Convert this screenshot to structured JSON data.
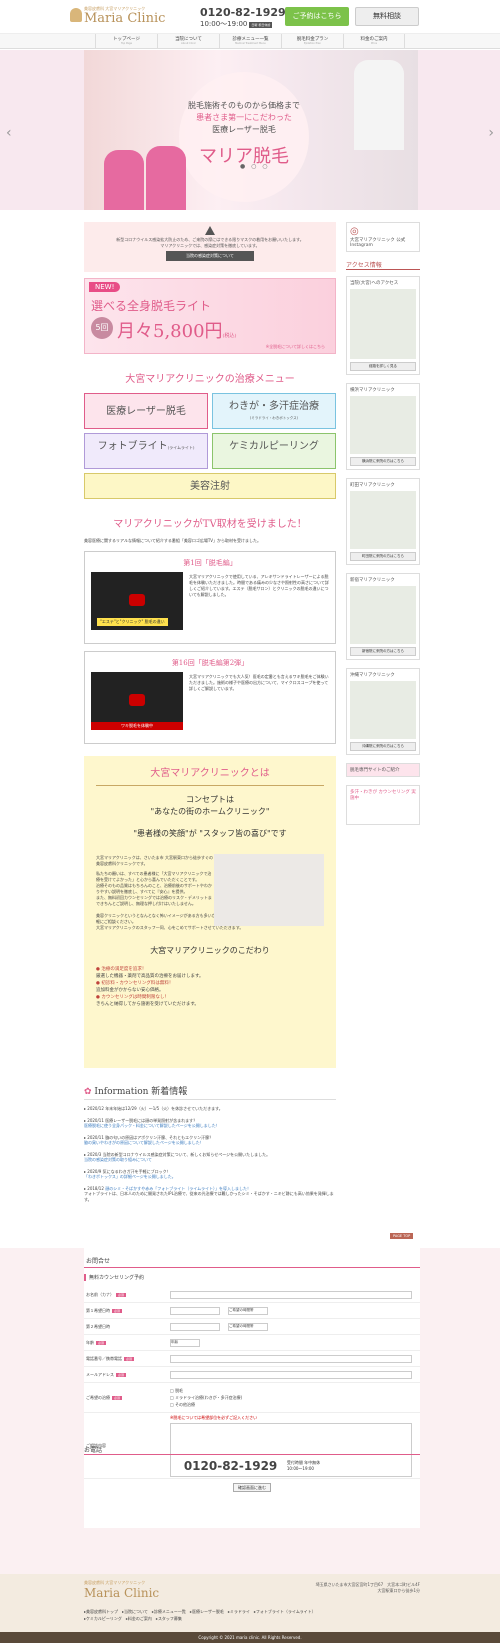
{
  "header": {
    "subtitle": "美容皮膚科 大宮マリアクリニック",
    "clinic_name": "Maria Clinic",
    "tel": "0120-82-1929",
    "hours": "10:00〜19:00",
    "hours_badge": "日曜\n祝日休診",
    "reserve_btn": "ご予約はこちら",
    "consult_btn": "無料相談"
  },
  "nav": [
    {
      "label": "トップページ",
      "sub": "Top Page"
    },
    {
      "label": "当院について",
      "sub": "About Clinic"
    },
    {
      "label": "診療メニュー一覧",
      "sub": "Medical Treatment Menu"
    },
    {
      "label": "脱毛料金プラン",
      "sub": "Epilation Plan"
    },
    {
      "label": "料金のご案内",
      "sub": "Price"
    }
  ],
  "hero": {
    "line1": "脱毛施術そのものから価格まで",
    "line2": "患者さま第一にこだわった",
    "line3": "医療レーザー脱毛",
    "title": "マリア脱毛"
  },
  "notice": {
    "text1": "新型コロナウイルス感染拡大防止のため、ご来院の際にはできる限りマスクの着用をお願いいたします。",
    "text2": "マリアクリニックでは、感染症対策を徹底しています。",
    "button": "当院の感染症対策について"
  },
  "promo": {
    "new": "NEW!",
    "title": "選べる全身脱毛ライト",
    "count": "5回",
    "price": "月々5,800円",
    "tax": "(税込)",
    "link": "※全脱毛について詳しくはこちら"
  },
  "menu": {
    "title": "大宮マリアクリニックの治療メニュー",
    "items": [
      {
        "label": "医療レーザー脱毛",
        "sub": ""
      },
      {
        "label": "わきが・多汗症治療",
        "sub": "(ミラドライ・わきボトックス)"
      },
      {
        "label": "フォトブライト",
        "sub": "(ライムライト)"
      },
      {
        "label": "ケミカルピーリング",
        "sub": ""
      },
      {
        "label": "美容注射",
        "sub": ""
      }
    ]
  },
  "tv": {
    "title": "マリアクリニックがTV取材を受けました！",
    "desc": "美容医療に関するリアルな情報について紹介する番組「美容ロゴ広場TV」から取材を受けました。",
    "items": [
      {
        "heading": "第1回「脱毛編」",
        "text": "大宮マリアクリニックで使用している、アレキサンドライトレーザーによる脱毛を体験いただきました。時間である痛みの少なさや照射性の高さについて詳しくご紹介しています。エステ（脱毛サロン）とクリニックの脱毛の違いについても解説しました。",
        "caption": "\"エステ\"と\"クリニック\" 脱毛の違い"
      },
      {
        "heading": "第16回「脱毛編第2弾」",
        "text": "大宮マリアクリニックでも大人気！医毛の定番とも言えるワキ脱毛をご体験いただきました。施術の様子や医療の出方について、マイクロスコープを使って詳しくご解説しています。",
        "caption": "ワキ脱毛を体験中"
      }
    ]
  },
  "about": {
    "title": "大宮マリアクリニックとは",
    "concept_label": "コンセプトは",
    "concept": "\"あなたの街のホームクリニック\"",
    "quote": "\"患者様の笑顔\"が \"スタッフ皆の喜び\"です",
    "p1": "大宮マリアクリニックは、さいたま市 大宮駅東口から徒歩すぐの美容皮膚科クリニックです。",
    "p2": "私たちの願いは、すべての患者様に「大宮マリアクリニックで治療を受けてよかった」と心から喜んでいただくことです。",
    "p3": "治療そのもの品質はもちろんのこと、治療前後のサポートやわかりやすい説明を徹底し、すべてに『安心』を提供。",
    "p4": "また、無料初回カウンセリングでは治療のリスク・デメリットまできちんとご説明し、無理な押し付けはいたしません。",
    "p5": "美容クリニックというとなんとなく怖いイメージがある方も多いかもしれませんが、まずはぜひ『町のお医者さん』感覚でお気軽にご相談ください。",
    "p6": "大宮マリアクリニックのスタッフ一同、心をこめてサポートさせていただきます。",
    "commit_title": "大宮マリアクリニックのこだわり",
    "commits": [
      "治療の満足度を追求！",
      "厳選した機器・薬剤で高品質の治療をお届けします。",
      "初診料・カウンセリング料は無料！",
      "追加料金がかからない安心価格。",
      "カウンセリングは時間制限なし！",
      "きちんと納得してから施術を受けていただけます。"
    ]
  },
  "info": {
    "title": "Information 新着情報",
    "items": [
      {
        "date": "2020/12",
        "text": "年末年始は12/29（火）〜1/5（火）を休診させていただきます。",
        "link": ""
      },
      {
        "date": "2020/11",
        "text": "医療レーザー脱毛には顔の単発照射が含まれます？",
        "link": "医療脱毛に使う全身パック・料金について解説したページを公開しました！"
      },
      {
        "date": "2020/11",
        "text": "脇の匂いの原因はアポクリン汗腺、それともエクリン汗腺？",
        "link": "脇の臭いやわきがの原因について解説したページを公開しました！"
      },
      {
        "date": "2020/3",
        "text": "当院の新型コロナウイルス感染症対策について、新しくお知らせページを公開いたしました。",
        "link": "当院の感染症対策の取り組みについて"
      },
      {
        "date": "2020/9",
        "text": "気になるわきガ汗を手軽にブロック！",
        "link": "「わきボトックス」の詳細ページを公開しました。"
      },
      {
        "date": "2018/12",
        "text": "顔のシミ・そばかすや赤み「フォトブライト（ライムライト）」を導入しました！",
        "link": "フォトブライトは、日本人のために開発されたIPL治療で、従来の光治療では難しかったシミ・そばかす・ニキビ跡にも高い効果を発揮します。"
      }
    ]
  },
  "side": {
    "instagram": "大宮マリアクリニック 公式Instagram",
    "access": "アクセス情報",
    "clinics": [
      {
        "name": "当院(大宮)へのアクセス",
        "btn": "経路を詳しく見る"
      },
      {
        "name": "横浜マリアクリニック",
        "btn": "横浜院に来院の方はこちら"
      },
      {
        "name": "町田マリアクリニック",
        "btn": "町田院に来院の方はこちら"
      },
      {
        "name": "新宿マリアクリニック",
        "btn": "新宿院に来院の方はこちら"
      },
      {
        "name": "沖縄マリアクリニック",
        "btn": "沖縄院に来院の方はこちら"
      }
    ],
    "promo1": "脱毛専門サイトのご紹介",
    "promo2": "多汗・わきが カウンセリング 実施中"
  },
  "pagetop": "PAGE TOP",
  "contact": {
    "title": "お問合せ",
    "form_title": "無料カウンセリング予約",
    "fields": [
      {
        "label": "お名前（カナ）",
        "req": "必須"
      },
      {
        "label": "第１希望日時",
        "req": "必須"
      },
      {
        "label": "第２希望日時",
        "req": ""
      },
      {
        "label": "年齢",
        "req": "必須"
      },
      {
        "label": "電話番号／携帯電話",
        "req": "必須"
      },
      {
        "label": "メールアドレス",
        "req": "必須"
      },
      {
        "label": "ご希望の治療",
        "req": "必須"
      },
      {
        "label": "ご相談内容",
        "req": ""
      }
    ],
    "checkbox": [
      "脱毛",
      "ミラドライ治療(わきが・多汗症治療)",
      "その他治療"
    ],
    "note": "※脱毛については希望部位を必ずご記入ください",
    "confirm": "確認画面に進む",
    "age_placeholder": "年齢",
    "time_placeholder": "ご希望の時間帯"
  },
  "phone": {
    "title": "お電話",
    "tel": "0120-82-1929",
    "hours": "受付時間 年中無休",
    "hours2": "10:00〜19:00"
  },
  "footer": {
    "address": "埼玉県さいたま市大宮区宮町1丁目67　大宮本ゴ町ビル4F",
    "access": "大宮駅東口から徒歩1分",
    "links": [
      "美容皮膚科トップ",
      "当院について",
      "診療メニュー一覧",
      "医療レーザー脱毛",
      "ミラドライ",
      "フォトブライト（ライムライト）",
      "ケミカルピーリング",
      "料金のご案内",
      "スタッフ募集"
    ],
    "copy": "Copyright © 2021 maria clinic. All Rights Reserved."
  }
}
